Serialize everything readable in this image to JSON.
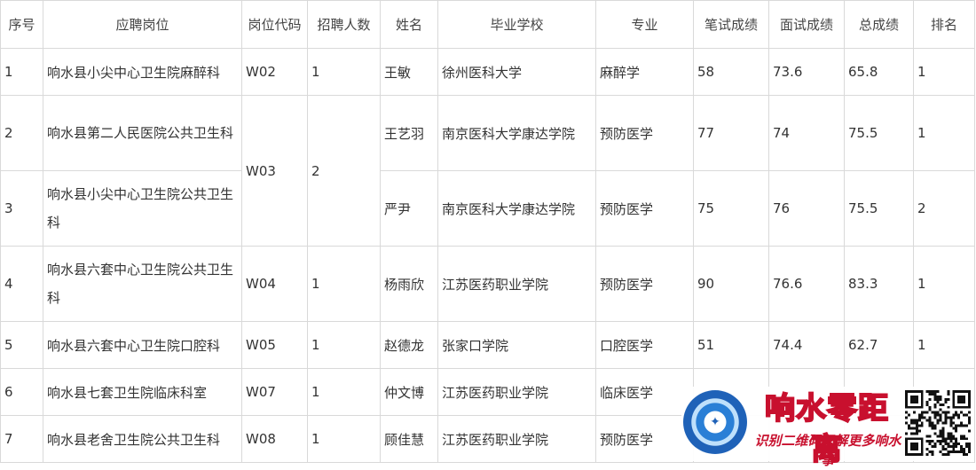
{
  "table": {
    "headers": [
      "序号",
      "应聘岗位",
      "岗位代码",
      "招聘人数",
      "姓名",
      "毕业学校",
      "专业",
      "笔试成绩",
      "面试成绩",
      "总成绩",
      "排名"
    ],
    "rows": [
      {
        "no": "1",
        "position": "响水县小尖中心卫生院麻醉科",
        "code": "W02",
        "count": "1",
        "name": "王敏",
        "school": "徐州医科大学",
        "major": "麻醉学",
        "written": "58",
        "interview": "73.6",
        "total": "65.8",
        "rank": "1"
      },
      {
        "no": "2",
        "position": "响水县第二人民医院公共卫生科",
        "code": "W03",
        "count": "2",
        "name": "王艺羽",
        "school": "南京医科大学康达学院",
        "major": "预防医学",
        "written": "77",
        "interview": "74",
        "total": "75.5",
        "rank": "1"
      },
      {
        "no": "3",
        "position": "响水县小尖中心卫生院公共卫生科",
        "code": "",
        "count": "",
        "name": "严尹",
        "school": "南京医科大学康达学院",
        "major": "预防医学",
        "written": "75",
        "interview": "76",
        "total": "75.5",
        "rank": "2"
      },
      {
        "no": "4",
        "position": "响水县六套中心卫生院公共卫生科",
        "code": "W04",
        "count": "1",
        "name": "杨雨欣",
        "school": "江苏医药职业学院",
        "major": "预防医学",
        "written": "90",
        "interview": "76.6",
        "total": "83.3",
        "rank": "1"
      },
      {
        "no": "5",
        "position": "响水县六套中心卫生院口腔科",
        "code": "W05",
        "count": "1",
        "name": "赵德龙",
        "school": "张家口学院",
        "major": "口腔医学",
        "written": "51",
        "interview": "74.4",
        "total": "62.7",
        "rank": "1"
      },
      {
        "no": "6",
        "position": "响水县七套卫生院临床科室",
        "code": "W07",
        "count": "1",
        "name": "仲文博",
        "school": "江苏医药职业学院",
        "major": "临床医学",
        "written": "",
        "interview": "",
        "total": "",
        "rank": ""
      },
      {
        "no": "7",
        "position": "响水县老舍卫生院公共卫生科",
        "code": "W08",
        "count": "1",
        "name": "顾佳慧",
        "school": "江苏医药职业学院",
        "major": "预防医学",
        "written": "",
        "interview": "",
        "total": "",
        "rank": ""
      }
    ]
  },
  "watermark": {
    "brand": "响水零距离",
    "slogan": "识别二维码了解更多响水事",
    "logo_icon": "globe-logo-icon",
    "qr_icon": "qr-code-icon",
    "brand_color": "#c8102e",
    "logo_color": "#1f62b8"
  }
}
